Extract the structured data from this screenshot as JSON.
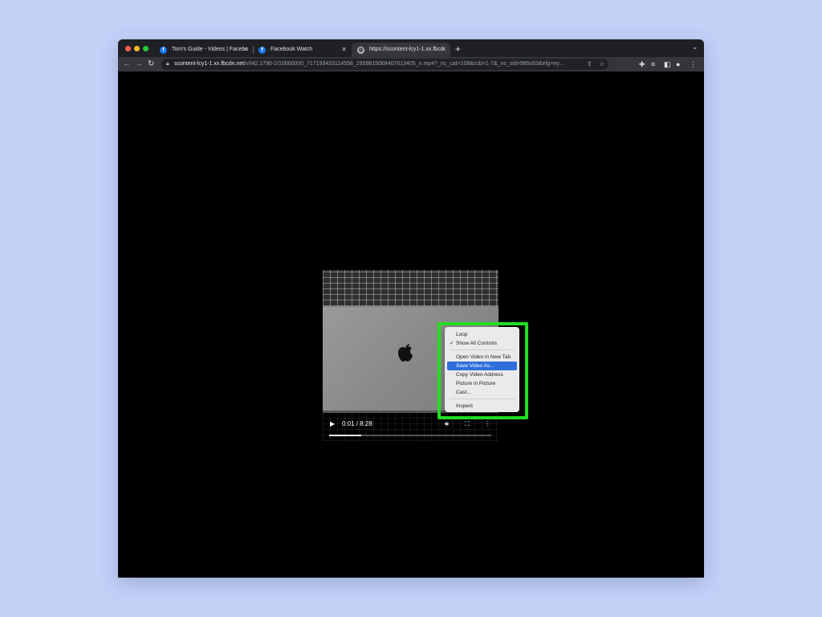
{
  "browser": {
    "tabs": [
      {
        "title": "Tom's Guide - Videos | Facebo",
        "favicon": "facebook-icon",
        "active": false
      },
      {
        "title": "Facebook Watch",
        "favicon": "facebook-icon",
        "active": false
      },
      {
        "title": "https://scontent-lcy1-1.xx.fbcd",
        "favicon": "globe-icon",
        "active": true
      }
    ],
    "new_tab_label": "+",
    "address": {
      "host": "scontent-lcy1-1.xx.fbcdn.net",
      "path": "/v/t42.1790-2/10000000_717193433114558_2959815068407613405_n.mp4?_nc_cat=108&ccb=1-7&_nc_sid=985c63&efg=ey..."
    }
  },
  "video": {
    "time": "0:01 / 8:28",
    "progress": 0.2
  },
  "context_menu": {
    "items": [
      {
        "label": "Loop",
        "checked": false,
        "selected": false
      },
      {
        "label": "Show All Controls",
        "checked": true,
        "selected": false
      },
      {
        "label": "Open Video in New Tab",
        "checked": false,
        "selected": false
      },
      {
        "label": "Save Video As...",
        "checked": false,
        "selected": true
      },
      {
        "label": "Copy Video Address",
        "checked": false,
        "selected": false
      },
      {
        "label": "Picture in Picture",
        "checked": false,
        "selected": false
      },
      {
        "label": "Cast...",
        "checked": false,
        "selected": false
      },
      {
        "label": "Inspect",
        "checked": false,
        "selected": false
      }
    ],
    "highlight_color": "#22dd22"
  },
  "colors": {
    "page_bg": "#c3d1f7",
    "tab_strip": "#1f2023",
    "toolbar": "#35363a",
    "menu_selection": "#2f6fdd"
  }
}
